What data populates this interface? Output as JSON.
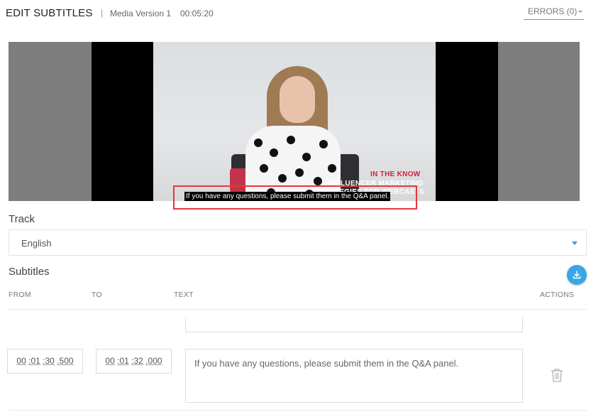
{
  "header": {
    "title": "EDIT SUBTITLES",
    "separator": "|",
    "media_version": "Media Version 1",
    "duration": "00:05:20",
    "errors_label": "ERRORS (0)"
  },
  "player": {
    "overlay_tag": "IN THE KNOW",
    "overlay_line1": "INFLUENCER MARKETING",
    "overlay_line2": "STRATEGIES FOR WEBCASTS",
    "caption": "If you have any questions, please submit them in the Q&A panel."
  },
  "track": {
    "label": "Track",
    "selected": "English"
  },
  "subtitles": {
    "label": "Subtitles",
    "columns": {
      "from": "FROM",
      "to": "TO",
      "text": "TEXT",
      "actions": "ACTIONS"
    },
    "rows": [
      {
        "from": {
          "h": "00",
          "m": "01",
          "s": "30",
          "ms": "500"
        },
        "to": {
          "h": "00",
          "m": "01",
          "s": "32",
          "ms": "000"
        },
        "text": "If you have any questions, please submit them in the Q&A panel."
      }
    ]
  },
  "colors": {
    "accent": "#39a7e6",
    "highlight": "#e0393e",
    "brand_red": "#d6203a"
  },
  "icons": {
    "download": "download-icon",
    "trash": "trash-icon",
    "chevron": "chevron-down-icon"
  }
}
